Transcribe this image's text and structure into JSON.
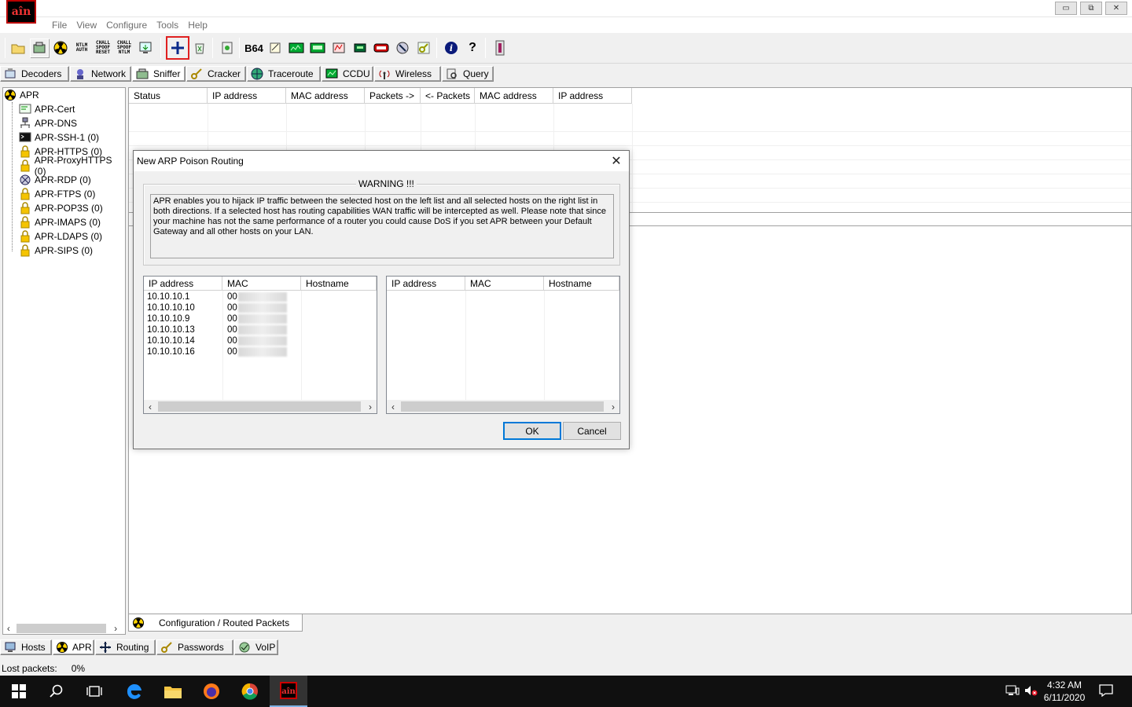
{
  "app": {
    "logo_text": "aîn",
    "window_buttons": [
      "▭",
      "⧉",
      "✕"
    ]
  },
  "menu": [
    "File",
    "View",
    "Configure",
    "Tools",
    "Help"
  ],
  "toolbar": {
    "ntlm_auth": "NTLM AUTH",
    "chall_spoof_reset": "CHALL SPOOF RESET",
    "chall_spoof_ntlm": "CHALL SPOOF NTLM",
    "b64": "B64"
  },
  "top_tabs": [
    {
      "label": "Decoders",
      "icon": "decoder-icon"
    },
    {
      "label": "Network",
      "icon": "network-icon"
    },
    {
      "label": "Sniffer",
      "icon": "sniffer-icon"
    },
    {
      "label": "Cracker",
      "icon": "key-icon"
    },
    {
      "label": "Traceroute",
      "icon": "globe-icon"
    },
    {
      "label": "CCDU",
      "icon": "monitor-icon"
    },
    {
      "label": "Wireless",
      "icon": "antenna-icon"
    },
    {
      "label": "Query",
      "icon": "query-icon"
    }
  ],
  "tree": {
    "root": "APR",
    "items": [
      "APR-Cert",
      "APR-DNS",
      "APR-SSH-1 (0)",
      "APR-HTTPS (0)",
      "APR-ProxyHTTPS (0)",
      "APR-RDP (0)",
      "APR-FTPS (0)",
      "APR-POP3S (0)",
      "APR-IMAPS (0)",
      "APR-LDAPS (0)",
      "APR-SIPS (0)"
    ]
  },
  "main_columns": [
    "Status",
    "IP address",
    "MAC address",
    "Packets ->",
    "<- Packets",
    "MAC address",
    "IP address"
  ],
  "bottom_tab": "Configuration / Routed Packets",
  "bottom_tabs": [
    {
      "label": "Hosts"
    },
    {
      "label": "APR"
    },
    {
      "label": "Routing"
    },
    {
      "label": "Passwords"
    },
    {
      "label": "VoIP"
    }
  ],
  "status": {
    "label": "Lost packets:",
    "value": "0%"
  },
  "dialog": {
    "title": "New ARP Poison Routing",
    "warning_title": "WARNING !!!",
    "warning_text": "APR enables you to hijack IP traffic between the selected host on the left list and all selected hosts on the right list in both directions. If a selected host has routing capabilities WAN traffic will be intercepted as well. Please note that since your machine has not the same performance of a router you could cause DoS if you set APR between your Default Gateway and all other hosts on your LAN.",
    "left_list": {
      "columns": [
        "IP address",
        "MAC",
        "Hostname"
      ],
      "rows": [
        {
          "ip": "10.10.10.1",
          "mac": "00"
        },
        {
          "ip": "10.10.10.10",
          "mac": "00"
        },
        {
          "ip": "10.10.10.9",
          "mac": "00"
        },
        {
          "ip": "10.10.10.13",
          "mac": "00"
        },
        {
          "ip": "10.10.10.14",
          "mac": "00"
        },
        {
          "ip": "10.10.10.16",
          "mac": "00"
        }
      ]
    },
    "right_list": {
      "columns": [
        "IP address",
        "MAC",
        "Hostname"
      ]
    },
    "ok_label": "OK",
    "cancel_label": "Cancel"
  },
  "taskbar": {
    "time": "4:32 AM",
    "date": "6/11/2020"
  }
}
